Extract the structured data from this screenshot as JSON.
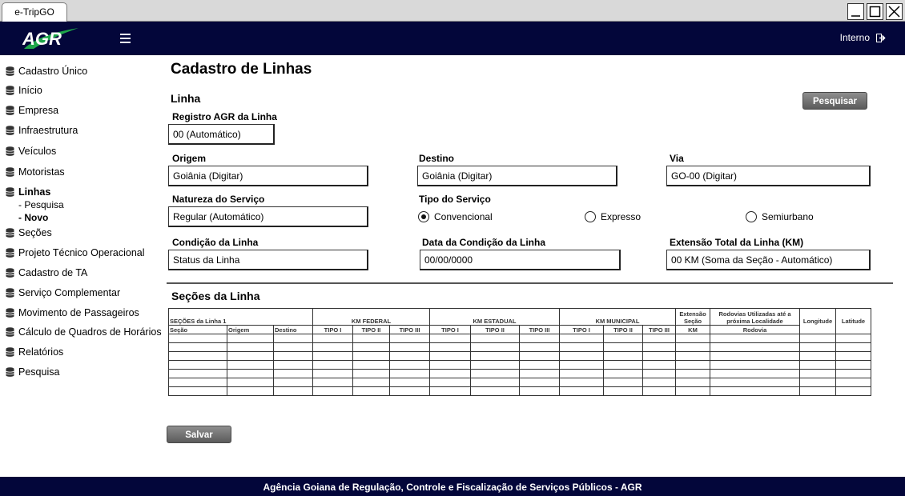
{
  "browser": {
    "tab_title": "e-TripGO"
  },
  "header": {
    "logo_text": "AGR",
    "user_label": "Interno"
  },
  "sidebar": {
    "items": [
      {
        "label": "Cadastro Único",
        "icon": "database-icon"
      },
      {
        "label": "Início",
        "icon": "database-icon"
      },
      {
        "label": "Empresa",
        "icon": "database-icon"
      },
      {
        "label": "Infraestrutura",
        "icon": "database-icon"
      },
      {
        "label": "Veículos",
        "icon": "database-icon"
      },
      {
        "label": "Motoristas",
        "icon": "database-icon"
      },
      {
        "label": "Linhas",
        "icon": "database-icon",
        "active": true
      },
      {
        "label": "Seções",
        "icon": "database-icon"
      },
      {
        "label": "Projeto Técnico Operacional",
        "icon": "database-icon"
      },
      {
        "label": "Cadastro de TA",
        "icon": "database-icon"
      },
      {
        "label": "Serviço Complementar",
        "icon": "database-icon"
      },
      {
        "label": "Movimento de Passageiros",
        "icon": "database-icon"
      },
      {
        "label": "Cálculo de Quadros de Horários",
        "icon": "database-icon"
      },
      {
        "label": "Relatórios",
        "icon": "database-icon"
      },
      {
        "label": "Pesquisa",
        "icon": "database-icon"
      }
    ],
    "sub_items": [
      {
        "label": "- Pesquisa"
      },
      {
        "label": "- Novo",
        "active": true
      }
    ]
  },
  "main": {
    "title": "Cadastro de Linhas",
    "section_linha": "Linha",
    "search_button": "Pesquisar",
    "fields": {
      "registro": {
        "label": "Registro AGR da Linha",
        "value": "00 (Automático)"
      },
      "origem": {
        "label": "Origem",
        "value": "Goiânia (Digitar)"
      },
      "destino": {
        "label": "Destino",
        "value": "Goiânia (Digitar)"
      },
      "via": {
        "label": "Via",
        "value": "GO-00 (Digitar)"
      },
      "natureza": {
        "label": "Natureza do Serviço",
        "value": "Regular (Automático)"
      },
      "condicao": {
        "label": "Condição da Linha",
        "value": "Status da Linha"
      },
      "data_condicao": {
        "label": "Data da Condição da Linha",
        "value": "00/00/0000"
      },
      "extensao": {
        "label": "Extensão Total da Linha (KM)",
        "value": "00 KM (Soma da Seção - Automático)"
      }
    },
    "tipo_servico": {
      "label": "Tipo do Serviço",
      "options": [
        "Convencional",
        "Expresso",
        "Semiurbano"
      ],
      "selected": "Convencional"
    },
    "section_secoes": "Seções da Linha",
    "table": {
      "group_headers": {
        "secoes": "SEÇÕES da Linha 1",
        "km_federal": "KM FEDERAL",
        "km_estadual": "KM ESTADUAL",
        "km_municipal": "KM MUNICIPAL",
        "extensao": "Extensão Seção",
        "rodovias": "Rodovias Utilizadas até a próxima Localidade",
        "longitude": "Longitude",
        "latitude": "Latitude"
      },
      "sub_headers": {
        "secao": "Seção",
        "origem": "Origem",
        "destino": "Destino",
        "tipo1": "TIPO I",
        "tipo2": "TIPO II",
        "tipo3": "TIPO III",
        "km": "KM",
        "rodovia": "Rodovia"
      },
      "empty_rows": 7
    },
    "save_button": "Salvar"
  },
  "footer": {
    "text": "Agência Goiana de Regulação, Controle e Fiscalização de Serviços Públicos - AGR"
  }
}
